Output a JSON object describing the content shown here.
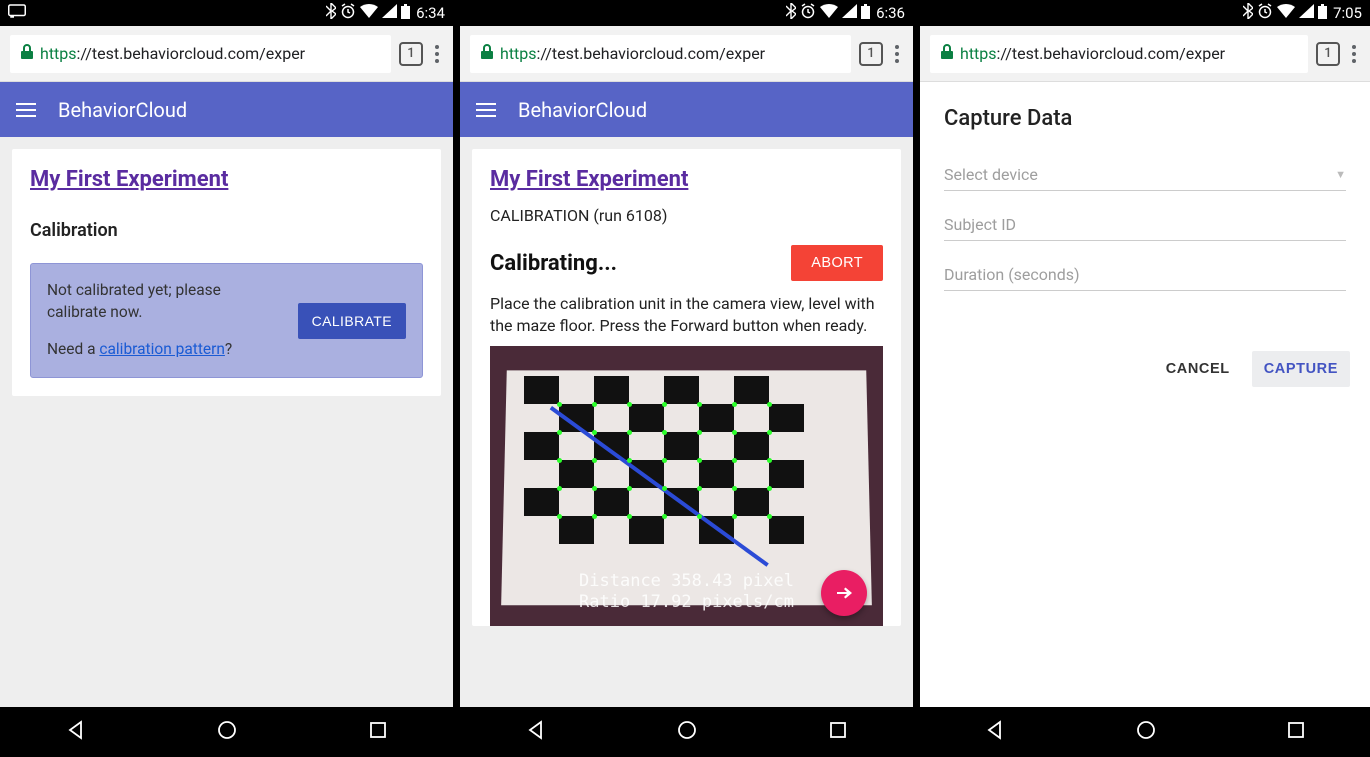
{
  "phones": [
    {
      "clock": "6:34",
      "url_https": "https",
      "url_rest": "://test.behaviorcloud.com/exper",
      "tab_count": "1",
      "app_title": "BehaviorCloud",
      "experiment_link": "My First Experiment",
      "section_heading": "Calibration",
      "callout_line1": "Not calibrated yet; please calibrate now.",
      "callout_line2_pre": "Need a ",
      "callout_link": "calibration pattern",
      "callout_line2_post": "?",
      "calibrate_btn": "CALIBRATE"
    },
    {
      "clock": "6:36",
      "url_https": "https",
      "url_rest": "://test.behaviorcloud.com/exper",
      "tab_count": "1",
      "app_title": "BehaviorCloud",
      "experiment_link": "My First Experiment",
      "run_line": "CALIBRATION (run 6108)",
      "calibrating_h": "Calibrating...",
      "abort_btn": "ABORT",
      "instructions": "Place the calibration unit in the camera view, level with the maze floor. Press the Forward button when ready.",
      "overlay_distance": "Distance 358.43 pixel",
      "overlay_ratio": "Ratio 17.92 pixels/cm"
    },
    {
      "clock": "7:05",
      "url_https": "https",
      "url_rest": "://test.behaviorcloud.com/exper",
      "tab_count": "1",
      "dialog_title": "Capture Data",
      "field_device": "Select device",
      "field_subject": "Subject ID",
      "field_duration": "Duration (seconds)",
      "cancel_btn": "CANCEL",
      "capture_btn": "CAPTURE"
    }
  ]
}
